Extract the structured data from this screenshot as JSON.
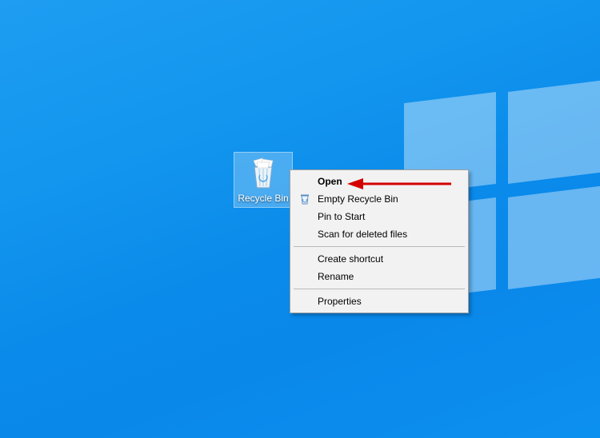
{
  "desktop": {
    "icon": {
      "label": "Recycle Bin",
      "icon_name": "recycle-bin-full-icon"
    }
  },
  "context_menu": {
    "items": [
      {
        "label": "Open",
        "bold": true,
        "icon": null
      },
      {
        "label": "Empty Recycle Bin",
        "bold": false,
        "icon": "recycle-bin-icon"
      },
      {
        "label": "Pin to Start",
        "bold": false,
        "icon": null
      },
      {
        "label": "Scan for deleted files",
        "bold": false,
        "icon": null
      }
    ],
    "items2": [
      {
        "label": "Create shortcut",
        "bold": false,
        "icon": null
      },
      {
        "label": "Rename",
        "bold": false,
        "icon": null
      }
    ],
    "items3": [
      {
        "label": "Properties",
        "bold": false,
        "icon": null
      }
    ]
  },
  "annotation": {
    "target": "context-menu-open",
    "color": "#d40000"
  }
}
